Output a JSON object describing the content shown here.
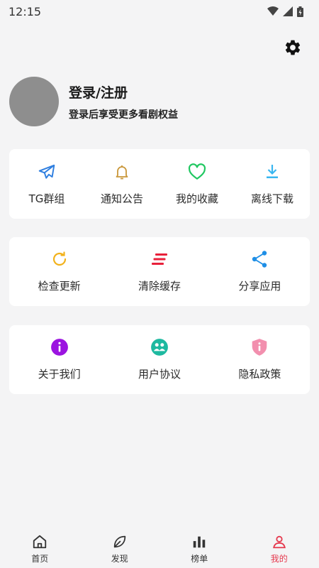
{
  "status": {
    "time": "12:15"
  },
  "profile": {
    "title": "登录/注册",
    "subtitle": "登录后享受更多看剧权益"
  },
  "card1": [
    {
      "label": "TG群组",
      "icon": "telegram-icon",
      "color": "#2f7fe0"
    },
    {
      "label": "通知公告",
      "icon": "bell-icon",
      "color": "#c9973a"
    },
    {
      "label": "我的收藏",
      "icon": "heart-icon",
      "color": "#1fc760"
    },
    {
      "label": "离线下载",
      "icon": "download-icon",
      "color": "#38b6f0"
    }
  ],
  "card2": [
    {
      "label": "检查更新",
      "icon": "refresh-icon",
      "color": "#f2b21c"
    },
    {
      "label": "清除缓存",
      "icon": "clear-icon",
      "color": "#e8203a"
    },
    {
      "label": "分享应用",
      "icon": "share-icon",
      "color": "#1f8fe6"
    }
  ],
  "card3": [
    {
      "label": "关于我们",
      "icon": "info-icon",
      "color": "#9b14e0"
    },
    {
      "label": "用户协议",
      "icon": "users-icon",
      "color": "#1db9a0"
    },
    {
      "label": "隐私政策",
      "icon": "shield-icon",
      "color": "#f28fae"
    }
  ],
  "tabs": [
    {
      "label": "首页",
      "icon": "home-icon"
    },
    {
      "label": "发现",
      "icon": "leaf-icon"
    },
    {
      "label": "榜单",
      "icon": "chart-icon"
    },
    {
      "label": "我的",
      "icon": "user-icon",
      "active_color": "#e53a4f"
    }
  ]
}
